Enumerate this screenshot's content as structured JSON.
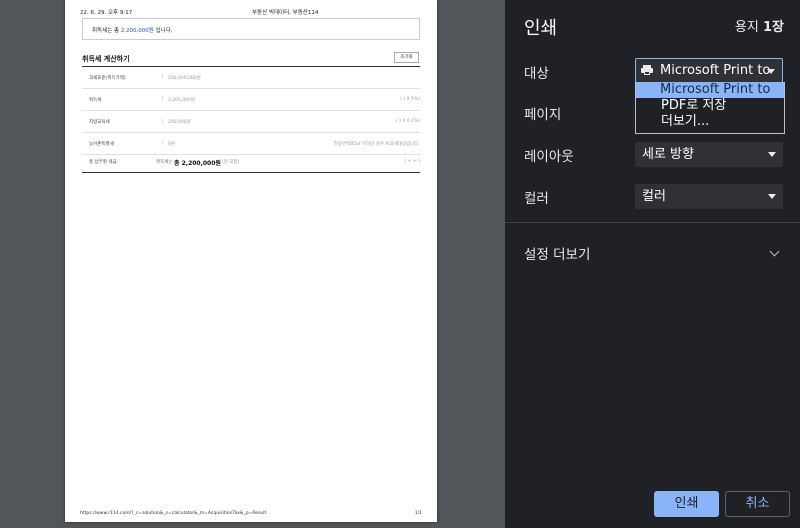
{
  "preview": {
    "header_date": "22. 6. 29. 오후 9:17",
    "header_site": "부동산 빅데이터, 부동산114",
    "result_prefix": "취득세는 총 ",
    "result_amount": "2,200,000원",
    "result_suffix": " 입니다.",
    "calc_title": "취득세 계산하기",
    "reset_label": "초기화",
    "rows": [
      {
        "label": "과세표준(취득가액)",
        "value": "200,000,000원",
        "right": ""
      },
      {
        "label": "취득세",
        "value": "2,200,000원",
        "right": "(      )    X  1%)"
      },
      {
        "label": "지방교육세",
        "value": "200,000원",
        "right": "(      )    X  0.1%)"
      },
      {
        "label": "농어촌특별세",
        "value": "0원",
        "right": "전용면적85㎡ 이하인 경우 비과세대상입니다."
      }
    ],
    "total": {
      "label": "총 납부할 세금",
      "pre": "취득세는",
      "amount": "총 2,200,000원",
      "unit": "(원 포함)",
      "right": "(    +    +    )"
    },
    "footer_url": "https://www.r114.com/?_c=solution&_s=calculator&_m=AcquisitionTax&_p=Result",
    "footer_page": "1/1"
  },
  "dialog": {
    "title": "인쇄",
    "sheets_prefix": "용지 ",
    "sheets_count": "1장",
    "destination": {
      "label": "대상",
      "selected": "Microsoft Print to",
      "icon": "printer-icon",
      "options": [
        "Microsoft Print to PDF",
        "PDF로 저장",
        "더보기..."
      ]
    },
    "pages": {
      "label": "페이지"
    },
    "layout": {
      "label": "레이아웃",
      "selected": "세로 방향"
    },
    "color": {
      "label": "컬러",
      "selected": "컬러"
    },
    "more_settings": "설정 더보기",
    "print_button": "인쇄",
    "cancel_button": "취소"
  },
  "colors": {
    "panel_bg": "#202124",
    "accent": "#8ab4f8",
    "preview_bg": "#525659"
  }
}
